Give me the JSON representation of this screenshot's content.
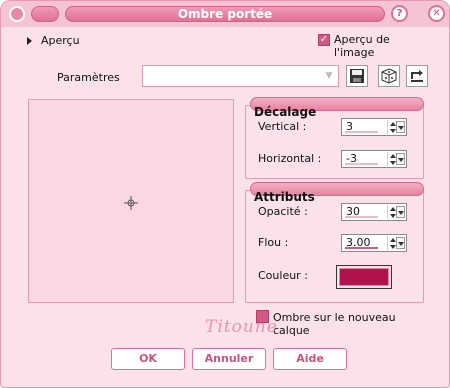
{
  "window": {
    "title": "Ombre portée",
    "help_btn": "?",
    "close_btn": "✕"
  },
  "preview_toggle": {
    "label": "Aperçu"
  },
  "preview_on_image": {
    "label": "Aperçu de l'image",
    "checked": true
  },
  "params": {
    "label": "Paramètres",
    "value": ""
  },
  "icons": {
    "save": "save-icon",
    "random": "dice-icon",
    "reset": "reset-icon"
  },
  "offset_group": {
    "title": "Décalage",
    "vertical": {
      "label": "Vertical :",
      "value": "3"
    },
    "horizontal": {
      "label": "Horizontal :",
      "value": "-3"
    }
  },
  "attributes_group": {
    "title": "Attributs",
    "opacity": {
      "label": "Opacité :",
      "value": "30"
    },
    "blur": {
      "label": "Flou :",
      "value": "3.00"
    },
    "color": {
      "label": "Couleur :",
      "value": "#b0124e"
    }
  },
  "new_layer": {
    "label": "Ombre sur le nouveau calque",
    "checked": true
  },
  "signature": "Titoune",
  "buttons": {
    "ok": "OK",
    "cancel": "Annuler",
    "help": "Aide"
  },
  "colors": {
    "accent": "#e07096",
    "dialog_bg": "#fbe2ea",
    "preview_bg": "#fad7e2",
    "shadow_color": "#b0124e"
  }
}
